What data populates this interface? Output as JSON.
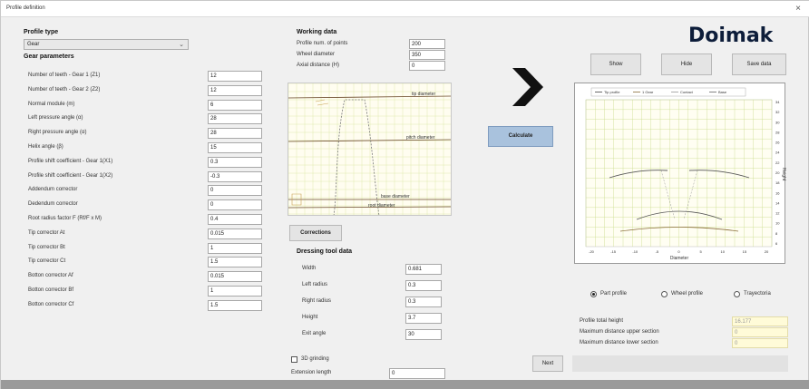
{
  "window": {
    "title": "Profile definition",
    "close": "×"
  },
  "logo": "Doimak",
  "profile_type": {
    "header": "Profile type",
    "selected": "Gear"
  },
  "gear_parameters": {
    "header": "Gear parameters",
    "rows": [
      {
        "label": "Number of teeth - Gear 1 (Z1)",
        "value": "12"
      },
      {
        "label": "Number of teeth - Gear 2 (Z2)",
        "value": "12"
      },
      {
        "label": "Normal module (m)",
        "value": "6"
      },
      {
        "label": "Left pressure angle (α)",
        "value": "28"
      },
      {
        "label": "Right pressure angle (α)",
        "value": "28"
      },
      {
        "label": "Helix angle (β)",
        "value": "15"
      },
      {
        "label": "Profile shift coefficient - Gear 1(X1)",
        "value": "0.3"
      },
      {
        "label": "Profile shift coefficient - Gear 1(X2)",
        "value": "-0.3"
      },
      {
        "label": "Addendum corrector",
        "value": "0"
      },
      {
        "label": "Dedendum corrector",
        "value": "0"
      },
      {
        "label": "Root radius factor F (Rf/F x M)",
        "value": "0.4"
      },
      {
        "label": "Tip corrector At",
        "value": "0.015"
      },
      {
        "label": "Tip corrector Bt",
        "value": "1"
      },
      {
        "label": "Tip corrector Ct",
        "value": "1.5"
      },
      {
        "label": "Botton corrector Af",
        "value": "0.015"
      },
      {
        "label": "Botton corrector Bf",
        "value": "1"
      },
      {
        "label": "Botton corrector Cf",
        "value": "1.5"
      }
    ]
  },
  "working_data": {
    "header": "Working data",
    "rows": [
      {
        "label": "Profile num. of points",
        "value": "200"
      },
      {
        "label": "Wheel diameter",
        "value": "350"
      },
      {
        "label": "Axial distance (H)",
        "value": "0"
      }
    ]
  },
  "tooth_plot": {
    "labels": {
      "tip": "tip diameter",
      "pitch": "pitch diameter",
      "base": "base diameter",
      "root": "root diameter"
    }
  },
  "corrections_button": "Corrections",
  "dressing": {
    "header": "Dressing tool data",
    "rows": [
      {
        "label": "Width",
        "value": "0.681"
      },
      {
        "label": "Left radius",
        "value": "0.3"
      },
      {
        "label": "Right radius",
        "value": "0.3"
      },
      {
        "label": "Height",
        "value": "3.7"
      },
      {
        "label": "Exit angle",
        "value": "30"
      }
    ]
  },
  "grinding": {
    "label": "3D grinding",
    "checked": false
  },
  "extension": {
    "label": "Extension length",
    "value": "0"
  },
  "calculate_button": "Calculate",
  "right_buttons": {
    "show": "Show",
    "hide": "Hide",
    "save": "Save data"
  },
  "profile_plot": {
    "legend": [
      "Tip profile",
      "1 Gear",
      "Contact",
      "Base"
    ],
    "x_label": "Diameter",
    "y_label": "Height",
    "x_ticks": [
      "-20",
      "-15",
      "-10",
      "-5",
      "0",
      "5",
      "10",
      "15",
      "20"
    ],
    "y_ticks": [
      "34",
      "32",
      "30",
      "28",
      "26",
      "24",
      "22",
      "20",
      "18",
      "16",
      "14",
      "12",
      "10",
      "8",
      "6"
    ]
  },
  "view_options": {
    "options": [
      "Part profile",
      "Wheel profile",
      "Trayectoria"
    ],
    "selected": "Part profile"
  },
  "results": {
    "rows": [
      {
        "label": "Profile total height",
        "value": "16.177"
      },
      {
        "label": "Maximum distance upper section",
        "value": "0"
      },
      {
        "label": "Maximum distance lower section",
        "value": "0"
      }
    ]
  },
  "next_button": "Next",
  "colors": {
    "accent_button": "#a9c2dd",
    "plot_bg": "#fffdf0",
    "grid": "#d8e6a0",
    "logo": "#0d1d3a"
  }
}
